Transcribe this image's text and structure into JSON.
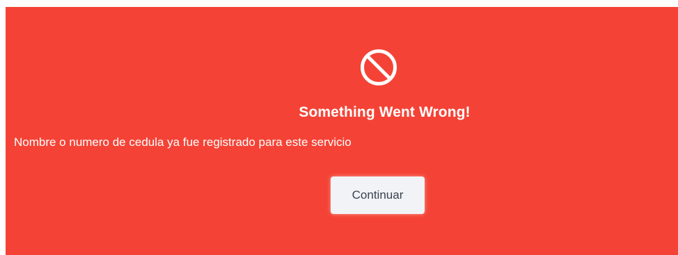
{
  "colors": {
    "background": "#f44336",
    "text": "#ffffff",
    "button_background": "#f1f3f6",
    "button_text": "#3b4250"
  },
  "alert": {
    "icon": "prohibited-icon",
    "title": "Something Went Wrong!",
    "message": "Nombre o numero de cedula ya fue registrado para este servicio",
    "button_label": "Continuar"
  }
}
